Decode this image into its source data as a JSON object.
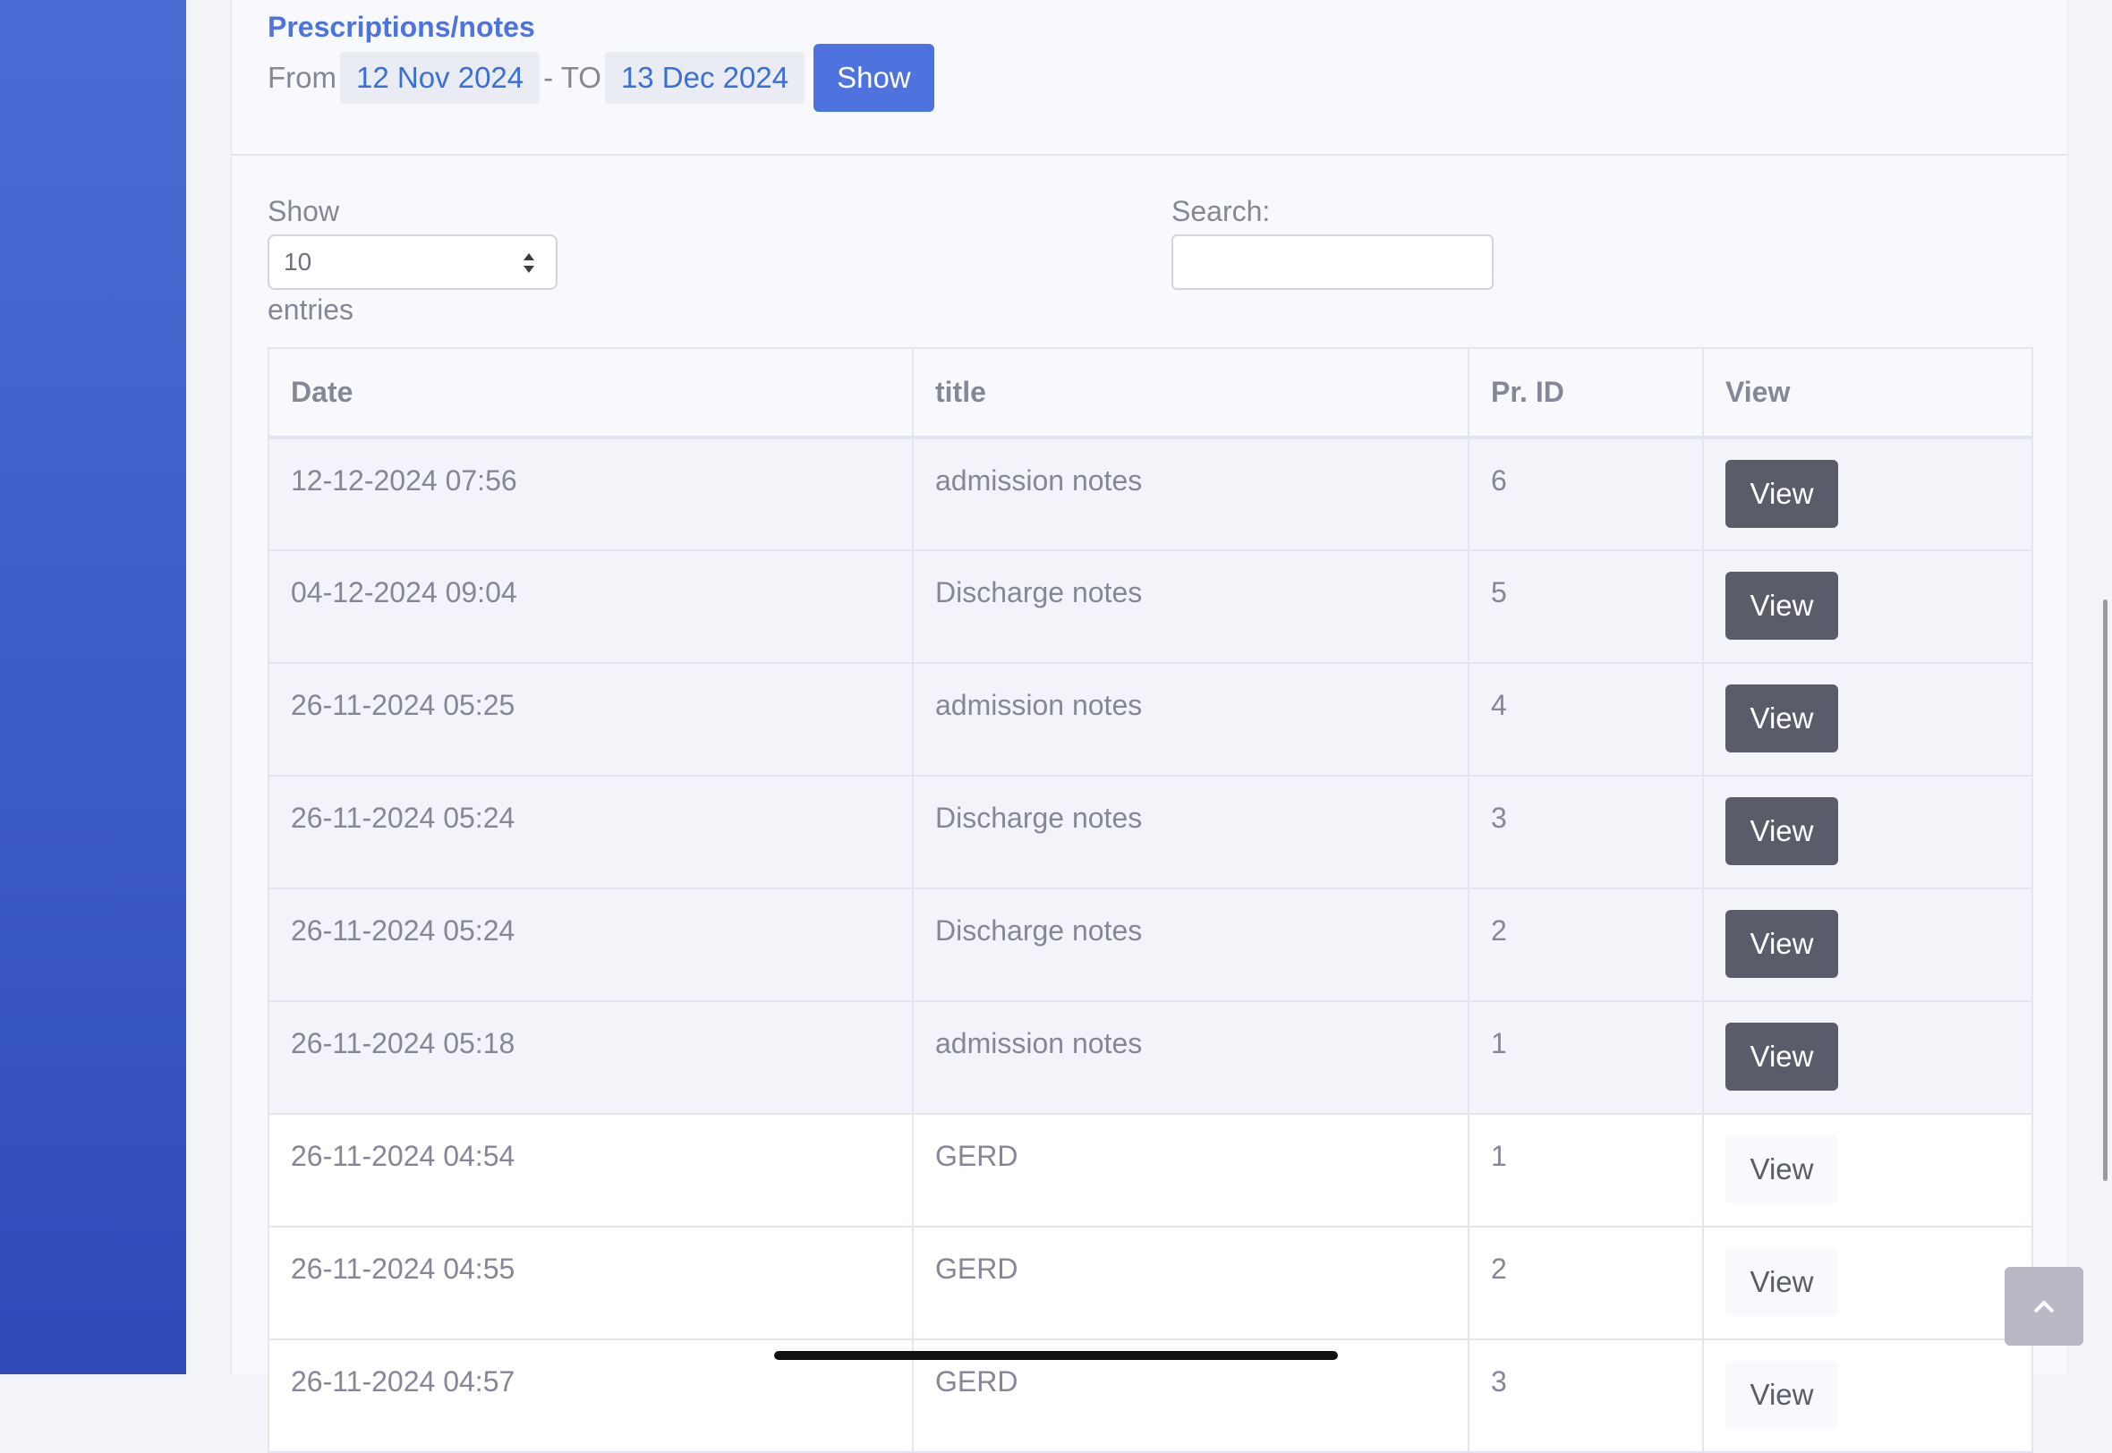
{
  "header": {
    "title": "Prescriptions/notes",
    "from_label": "From",
    "from_date": "12 Nov 2024",
    "to_label": "- TO",
    "to_date": "13 Dec 2024",
    "show_button": "Show"
  },
  "controls": {
    "length_label": "Show",
    "length_value": "10",
    "entries_label": "entries",
    "search_label": "Search:",
    "search_value": ""
  },
  "table": {
    "columns": [
      "Date",
      "title",
      "Pr. ID",
      "View"
    ],
    "rows": [
      {
        "date": "12-12-2024 07:56",
        "title": "admission notes",
        "pr_id": "6",
        "view": "View",
        "style": "dark"
      },
      {
        "date": "04-12-2024 09:04",
        "title": "Discharge notes",
        "pr_id": "5",
        "view": "View",
        "style": "dark"
      },
      {
        "date": "26-11-2024 05:25",
        "title": "admission notes",
        "pr_id": "4",
        "view": "View",
        "style": "dark"
      },
      {
        "date": "26-11-2024 05:24",
        "title": "Discharge notes",
        "pr_id": "3",
        "view": "View",
        "style": "dark"
      },
      {
        "date": "26-11-2024 05:24",
        "title": "Discharge notes",
        "pr_id": "2",
        "view": "View",
        "style": "dark"
      },
      {
        "date": "26-11-2024 05:18",
        "title": "admission notes",
        "pr_id": "1",
        "view": "View",
        "style": "dark"
      },
      {
        "date": "26-11-2024 04:54",
        "title": "GERD",
        "pr_id": "1",
        "view": "View",
        "style": "light"
      },
      {
        "date": "26-11-2024 04:55",
        "title": "GERD",
        "pr_id": "2",
        "view": "View",
        "style": "light"
      },
      {
        "date": "26-11-2024 04:57",
        "title": "GERD",
        "pr_id": "3",
        "view": "View",
        "style": "light"
      }
    ]
  },
  "icons": {
    "scroll_top": "chevron-up-icon",
    "select_arrows": "sort-arrows-icon"
  },
  "colors": {
    "accent": "#4e73df",
    "dark_button": "#5a5c69",
    "sidebar": "#3e5cc8"
  }
}
